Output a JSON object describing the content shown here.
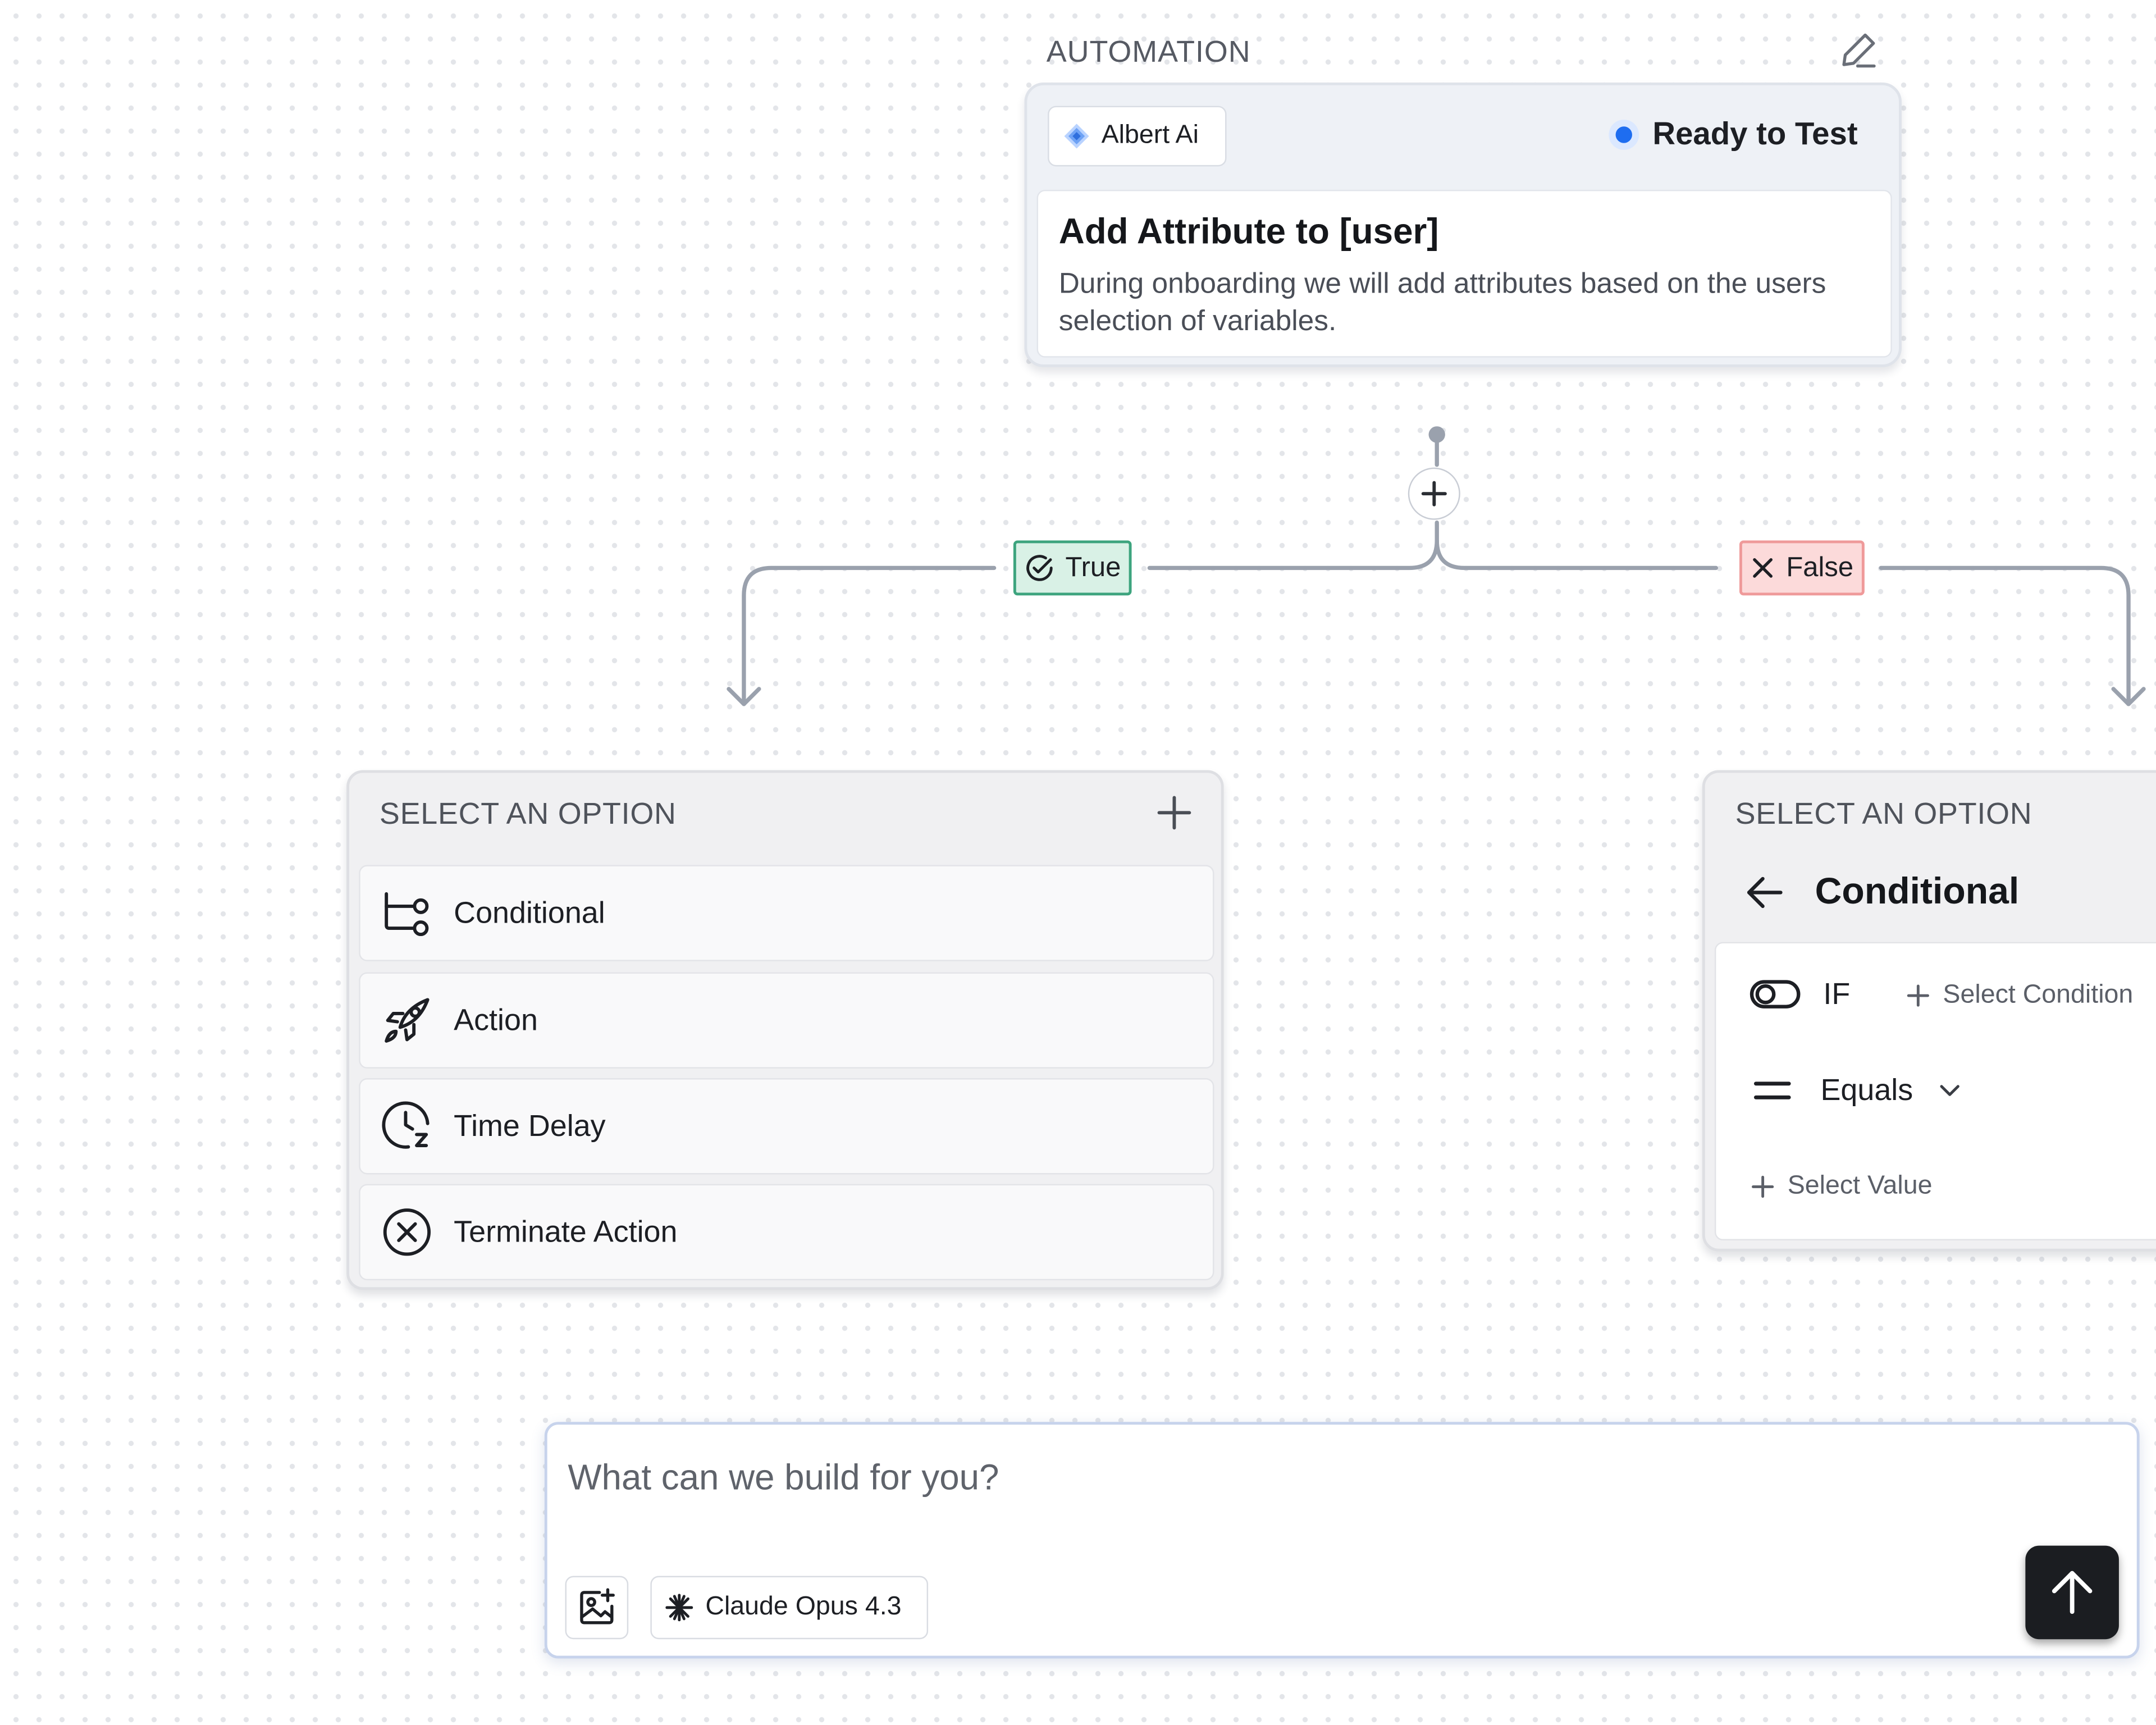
{
  "automation": {
    "section_label": "AUTOMATION",
    "edit_icon": "pencil-icon",
    "agent_name": "Albert Ai",
    "status": "Ready to Test",
    "status_color": "#1e6df0",
    "title": "Add Attribute to [user]",
    "description": "During onboarding we will add attributes based on the users selection of variables."
  },
  "branches": {
    "true_label": "True",
    "false_label": "False",
    "true_color": "#3da47e",
    "false_color": "#ef9a9a"
  },
  "option_panel": {
    "header": "SELECT AN OPTION",
    "options": [
      {
        "label": "Conditional",
        "icon": "branch-icon"
      },
      {
        "label": "Action",
        "icon": "rocket-icon"
      },
      {
        "label": "Time Delay",
        "icon": "clock-snooze-icon"
      },
      {
        "label": "Terminate Action",
        "icon": "x-circle-icon"
      }
    ]
  },
  "conditional_panel": {
    "header": "SELECT AN OPTION",
    "title": "Conditional",
    "if_label": "IF",
    "select_condition": "Select Condition",
    "operator": "Equals",
    "select_value": "Select Value"
  },
  "prompt": {
    "placeholder": "What can we build for you?",
    "model": "Claude Opus 4.3"
  }
}
